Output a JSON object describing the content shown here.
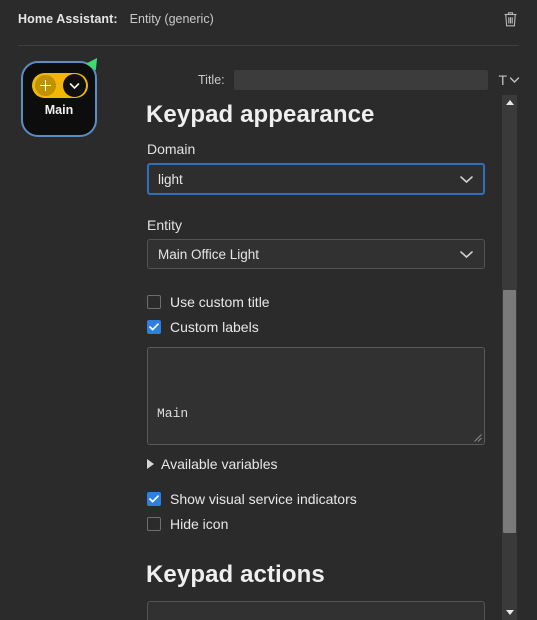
{
  "header": {
    "app_label": "Home Assistant:",
    "entity_type": "Entity (generic)",
    "delete_icon": "trash-icon"
  },
  "icon_tile": {
    "label": "Main",
    "badge_color": "#3ddc6e",
    "pill_color": "#f2b705",
    "selected_border_color": "#5b8cc4",
    "plus_icon": "plus-icon",
    "chevron_icon": "chevron-down-icon"
  },
  "title_row": {
    "label": "Title:",
    "value": "",
    "placeholder": "",
    "font_button": "T",
    "font_button_icon": "chevron-down-icon"
  },
  "form": {
    "appearance_heading": "Keypad appearance",
    "domain": {
      "label": "Domain",
      "value": "light",
      "focused": true,
      "focus_color": "#2f6fbb",
      "chevron_icon": "chevron-down-icon"
    },
    "entity": {
      "label": "Entity",
      "value": "Main Office Light",
      "chevron_icon": "chevron-down-icon"
    },
    "use_custom_title": {
      "label": "Use custom title",
      "checked": false
    },
    "custom_labels": {
      "label": "Custom labels",
      "checked": true,
      "check_color": "#2f7fe0"
    },
    "labels_textarea": {
      "value": "Main"
    },
    "available_variables": {
      "label": "Available variables",
      "expanded": false
    },
    "show_visual_service_indicators": {
      "label": "Show visual service indicators",
      "checked": true
    },
    "hide_icon": {
      "label": "Hide icon",
      "checked": false
    },
    "actions_heading": "Keypad actions",
    "actions_input_value": ""
  },
  "scrollbar": {
    "up_icon": "scroll-up-arrow-icon",
    "down_icon": "scroll-down-arrow-icon"
  }
}
